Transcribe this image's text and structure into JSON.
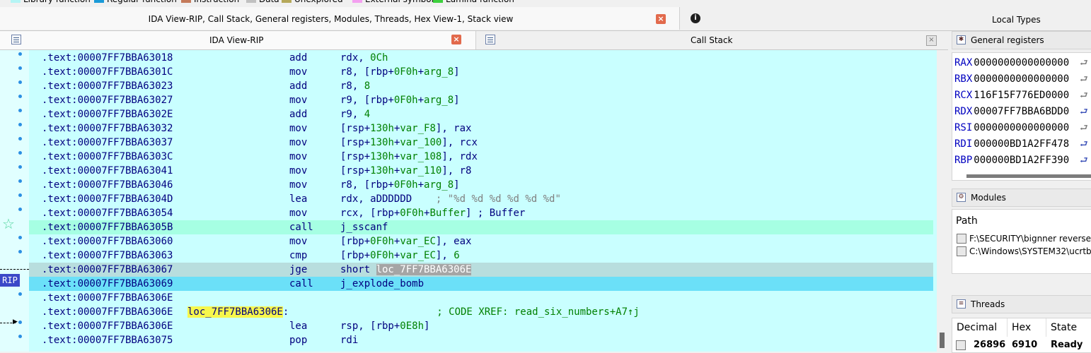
{
  "legend": [
    {
      "label": "Library function",
      "color": "#b5f5f5"
    },
    {
      "label": "Regular function",
      "color": "#1a9ad8"
    },
    {
      "label": "Instruction",
      "color": "#c47a5a"
    },
    {
      "label": "Data",
      "color": "#c0c0c0"
    },
    {
      "label": "Unexplored",
      "color": "#b5a85a"
    },
    {
      "label": "External symbol",
      "color": "#f4a0f0"
    },
    {
      "label": "Lumina function",
      "color": "#3cd03c"
    }
  ],
  "top_tabs": {
    "main": "IDA View-RIP, Call Stack, General registers, Modules, Threads, Hex View-1, Stack view",
    "right": "Local Types",
    "close_glyph": "×",
    "info_glyph": "i"
  },
  "sub_tabs": {
    "ida_view": "IDA View-RIP",
    "call_stack": "Call Stack"
  },
  "disasm": {
    "rip_label": "RIP",
    "rows": [
      {
        "addr": ".text:00007FF7BBA63018",
        "mn": "add",
        "ops": [
          {
            "t": "rdx, ",
            "c": "b"
          },
          {
            "t": "0Ch",
            "c": "g"
          }
        ]
      },
      {
        "addr": ".text:00007FF7BBA6301C",
        "mn": "mov",
        "ops": [
          {
            "t": "r8, [rbp+",
            "c": "b"
          },
          {
            "t": "0F0h",
            "c": "g"
          },
          {
            "t": "+",
            "c": "b"
          },
          {
            "t": "arg_8",
            "c": "g"
          },
          {
            "t": "]",
            "c": "b"
          }
        ]
      },
      {
        "addr": ".text:00007FF7BBA63023",
        "mn": "add",
        "ops": [
          {
            "t": "r8, ",
            "c": "b"
          },
          {
            "t": "8",
            "c": "g"
          }
        ]
      },
      {
        "addr": ".text:00007FF7BBA63027",
        "mn": "mov",
        "ops": [
          {
            "t": "r9, [rbp+",
            "c": "b"
          },
          {
            "t": "0F0h",
            "c": "g"
          },
          {
            "t": "+",
            "c": "b"
          },
          {
            "t": "arg_8",
            "c": "g"
          },
          {
            "t": "]",
            "c": "b"
          }
        ]
      },
      {
        "addr": ".text:00007FF7BBA6302E",
        "mn": "add",
        "ops": [
          {
            "t": "r9, ",
            "c": "b"
          },
          {
            "t": "4",
            "c": "g"
          }
        ]
      },
      {
        "addr": ".text:00007FF7BBA63032",
        "mn": "mov",
        "ops": [
          {
            "t": "[rsp+",
            "c": "b"
          },
          {
            "t": "130h",
            "c": "g"
          },
          {
            "t": "+",
            "c": "b"
          },
          {
            "t": "var_F8",
            "c": "g"
          },
          {
            "t": "], rax",
            "c": "b"
          }
        ]
      },
      {
        "addr": ".text:00007FF7BBA63037",
        "mn": "mov",
        "ops": [
          {
            "t": "[rsp+",
            "c": "b"
          },
          {
            "t": "130h",
            "c": "g"
          },
          {
            "t": "+",
            "c": "b"
          },
          {
            "t": "var_100",
            "c": "g"
          },
          {
            "t": "], rcx",
            "c": "b"
          }
        ]
      },
      {
        "addr": ".text:00007FF7BBA6303C",
        "mn": "mov",
        "ops": [
          {
            "t": "[rsp+",
            "c": "b"
          },
          {
            "t": "130h",
            "c": "g"
          },
          {
            "t": "+",
            "c": "b"
          },
          {
            "t": "var_108",
            "c": "g"
          },
          {
            "t": "], rdx",
            "c": "b"
          }
        ]
      },
      {
        "addr": ".text:00007FF7BBA63041",
        "mn": "mov",
        "ops": [
          {
            "t": "[rsp+",
            "c": "b"
          },
          {
            "t": "130h",
            "c": "g"
          },
          {
            "t": "+",
            "c": "b"
          },
          {
            "t": "var_110",
            "c": "g"
          },
          {
            "t": "], r8",
            "c": "b"
          }
        ]
      },
      {
        "addr": ".text:00007FF7BBA63046",
        "mn": "mov",
        "ops": [
          {
            "t": "r8, [rbp+",
            "c": "b"
          },
          {
            "t": "0F0h",
            "c": "g"
          },
          {
            "t": "+",
            "c": "b"
          },
          {
            "t": "arg_8",
            "c": "g"
          },
          {
            "t": "]",
            "c": "b"
          }
        ]
      },
      {
        "addr": ".text:00007FF7BBA6304D",
        "mn": "lea",
        "ops": [
          {
            "t": "rdx, aDDDDDD",
            "c": "b"
          },
          {
            "t": "    ; \"%d %d %d %d %d %d\"",
            "c": "gr"
          }
        ]
      },
      {
        "addr": ".text:00007FF7BBA63054",
        "mn": "mov",
        "ops": [
          {
            "t": "rcx, [rbp+",
            "c": "b"
          },
          {
            "t": "0F0h",
            "c": "g"
          },
          {
            "t": "+",
            "c": "b"
          },
          {
            "t": "Buffer",
            "c": "g"
          },
          {
            "t": "] ; Buffer",
            "c": "b"
          }
        ]
      },
      {
        "addr": ".text:00007FF7BBA6305B",
        "mn": "call",
        "hl": "call",
        "ops": [
          {
            "t": "j_sscanf",
            "c": "b"
          }
        ]
      },
      {
        "addr": ".text:00007FF7BBA63060",
        "mn": "mov",
        "ops": [
          {
            "t": "[rbp+",
            "c": "b"
          },
          {
            "t": "0F0h",
            "c": "g"
          },
          {
            "t": "+",
            "c": "b"
          },
          {
            "t": "var_EC",
            "c": "g"
          },
          {
            "t": "], eax",
            "c": "b"
          }
        ]
      },
      {
        "addr": ".text:00007FF7BBA63063",
        "mn": "cmp",
        "ops": [
          {
            "t": "[rbp+",
            "c": "b"
          },
          {
            "t": "0F0h",
            "c": "g"
          },
          {
            "t": "+",
            "c": "b"
          },
          {
            "t": "var_EC",
            "c": "g"
          },
          {
            "t": "], ",
            "c": "b"
          },
          {
            "t": "6",
            "c": "g"
          }
        ]
      },
      {
        "addr": ".text:00007FF7BBA63067",
        "mn": "jge",
        "hl": "cur",
        "ops": [
          {
            "t": "short ",
            "c": "b"
          },
          {
            "t": "loc_7FF7BBA6306E",
            "c": "sel"
          }
        ]
      },
      {
        "addr": ".text:00007FF7BBA63069",
        "mn": "call",
        "hl": "rip",
        "ops": [
          {
            "t": "j_explode_bomb",
            "c": "b"
          }
        ]
      },
      {
        "addr": ".text:00007FF7BBA6306E",
        "mn": "",
        "ops": []
      },
      {
        "addr": ".text:00007FF7BBA6306E",
        "label": "loc_7FF7BBA6306E",
        "label_suffix": ":",
        "mn": "",
        "ops": [
          {
            "t": "                        ; CODE XREF: read_six_numbers+A7↑j",
            "c": "cm"
          }
        ]
      },
      {
        "addr": ".text:00007FF7BBA6306E",
        "mn": "lea",
        "ops": [
          {
            "t": "rsp, [rbp+",
            "c": "b"
          },
          {
            "t": "0E8h",
            "c": "g"
          },
          {
            "t": "]",
            "c": "b"
          }
        ]
      },
      {
        "addr": ".text:00007FF7BBA63075",
        "mn": "pop",
        "ops": [
          {
            "t": "rdi",
            "c": "b"
          }
        ]
      }
    ]
  },
  "registers": {
    "title": "General registers",
    "items": [
      {
        "name": "RAX",
        "value": "0000000000000000",
        "arrow": "grey"
      },
      {
        "name": "RBX",
        "value": "0000000000000000",
        "arrow": "grey"
      },
      {
        "name": "RCX",
        "value": "116F15F776ED0000",
        "arrow": "grey"
      },
      {
        "name": "RDX",
        "value": "00007FF7BBA6BDD0",
        "arrow": "blue"
      },
      {
        "name": "RSI",
        "value": "0000000000000000",
        "arrow": "grey"
      },
      {
        "name": "RDI",
        "value": "000000BD1A2FF478",
        "arrow": "blue"
      },
      {
        "name": "RBP",
        "value": "000000BD1A2FF390",
        "arrow": "blue"
      }
    ]
  },
  "modules": {
    "title": "Modules",
    "column": "Path",
    "items": [
      "F:\\SECURITY\\bignner reverse",
      "C:\\Windows\\SYSTEM32\\ucrtb"
    ]
  },
  "threads": {
    "title": "Threads",
    "columns": [
      "Decimal",
      "Hex",
      "State"
    ],
    "rows": [
      {
        "decimal": "26896",
        "hex": "6910",
        "state": "Ready"
      }
    ]
  }
}
